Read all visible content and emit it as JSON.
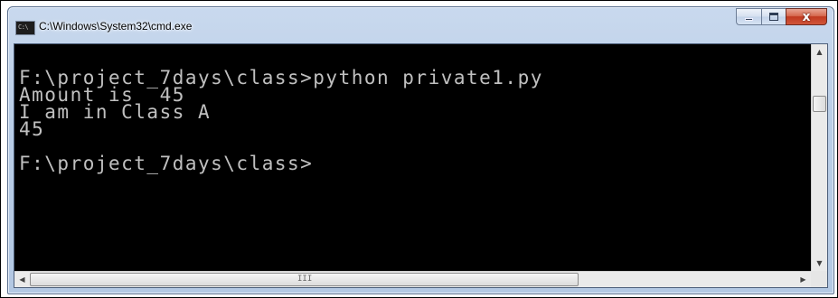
{
  "window": {
    "title": "C:\\Windows\\System32\\cmd.exe",
    "icon_text": "C:\\"
  },
  "caption_buttons": {
    "minimize_icon": "minimize-icon",
    "maximize_icon": "maximize-icon",
    "close_icon": "close-icon",
    "close_glyph": "x",
    "close_color": "#c0391f"
  },
  "console": {
    "lines": [
      "F:\\project_7days\\class>python private1.py",
      "Amount is  45",
      "I am in Class A",
      "45",
      "",
      "F:\\project_7days\\class>"
    ],
    "text_color": "#c0c0c0",
    "background": "#000000"
  },
  "scrollbars": {
    "up_arrow": "▲",
    "down_arrow": "▼",
    "left_arrow": "◀",
    "right_arrow": "▶",
    "h_grip": "III"
  }
}
